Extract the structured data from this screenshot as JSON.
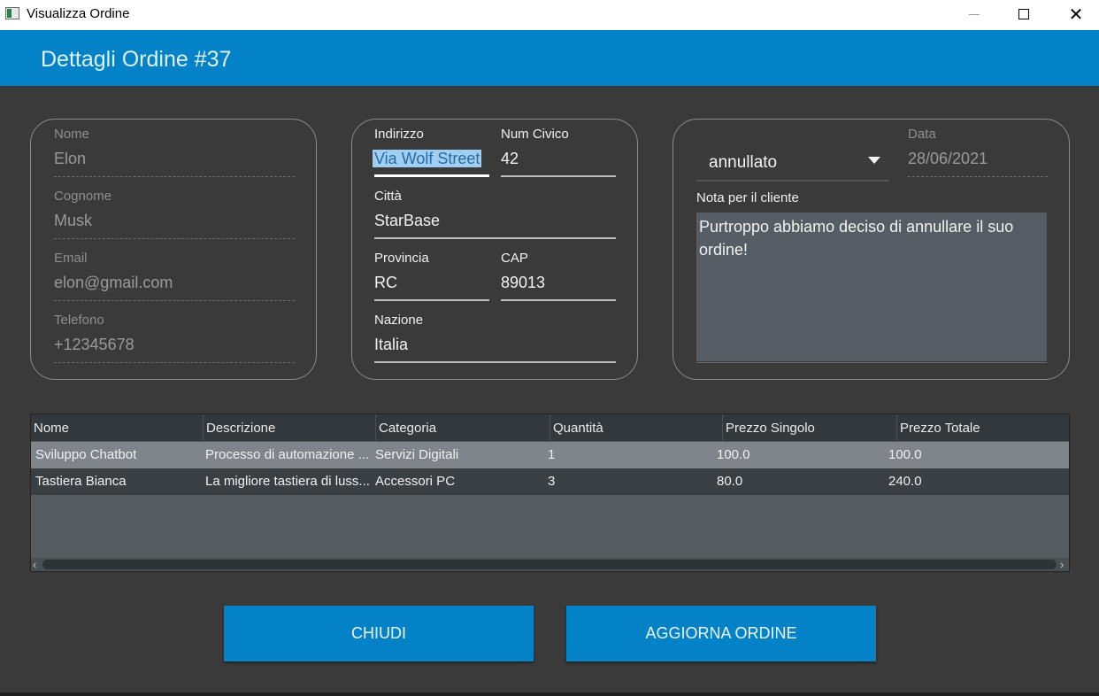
{
  "window": {
    "title": "Visualizza Ordine",
    "minimize": "—",
    "maximize": "☐",
    "close": "✕"
  },
  "header": {
    "title": "Dettagli Ordine #37"
  },
  "customer": {
    "nome_label": "Nome",
    "nome": "Elon",
    "cognome_label": "Cognome",
    "cognome": "Musk",
    "email_label": "Email",
    "email": "elon@gmail.com",
    "telefono_label": "Telefono",
    "telefono": "+12345678"
  },
  "address": {
    "indirizzo_label": "Indirizzo",
    "indirizzo": "Via Wolf Street",
    "civico_label": "Num Civico",
    "civico": "42",
    "citta_label": "Città",
    "citta": "StarBase",
    "provincia_label": "Provincia",
    "provincia": "RC",
    "cap_label": "CAP",
    "cap": "89013",
    "nazione_label": "Nazione",
    "nazione": "Italia"
  },
  "status": {
    "selected": "annullato",
    "data_label": "Data",
    "data": "28/06/2021",
    "note_label": "Nota per il cliente",
    "note": "Purtroppo abbiamo deciso di annullare il suo ordine!"
  },
  "table": {
    "columns": [
      "Nome",
      "Descrizione",
      "Categoria",
      "Quantità",
      "Prezzo Singolo",
      "Prezzo Totale"
    ],
    "rows": [
      [
        "Sviluppo Chatbot",
        "Processo di automazione ...",
        "Servizi Digitali",
        "1",
        "100.0",
        "100.0"
      ],
      [
        "Tastiera Bianca",
        "La migliore tastiera di luss...",
        "Accessori PC",
        "3",
        "80.0",
        "240.0"
      ]
    ]
  },
  "buttons": {
    "close": "CHIUDI",
    "update": "AGGIORNA ORDINE"
  },
  "colors": {
    "accent": "#0482c8",
    "background": "#3a3a3a",
    "selection": "#9fd0f3"
  }
}
